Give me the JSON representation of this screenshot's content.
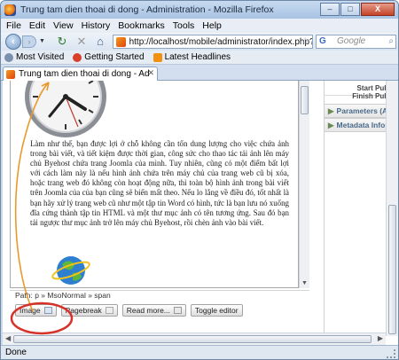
{
  "window": {
    "title": "Trung tam dien thoai di dong - Administration - Mozilla Firefox",
    "controls": {
      "minimize": "–",
      "maximize": "□",
      "close": "X"
    }
  },
  "menubar": {
    "items": [
      {
        "label": "File"
      },
      {
        "label": "Edit"
      },
      {
        "label": "View"
      },
      {
        "label": "History"
      },
      {
        "label": "Bookmarks"
      },
      {
        "label": "Tools"
      },
      {
        "label": "Help"
      }
    ]
  },
  "navigation": {
    "url": "http://localhost/mobile/administrator/index.php?o",
    "search_placeholder": "Google",
    "search_engine_label": "G"
  },
  "bookmarks": [
    {
      "label": "Most Visited",
      "icon": "gear-icon"
    },
    {
      "label": "Getting Started",
      "icon": "firefox-icon"
    },
    {
      "label": "Latest Headlines",
      "icon": "rss-icon"
    }
  ],
  "tab": {
    "label": "Trung tam dien thoai di dong - Admin..."
  },
  "editor": {
    "body_text": "Làm như thế, bạn được lợi ở chỗ không cần tốn dung lượng cho việc chứa ảnh trong bài viết, và tiết kiệm được thời gian, công sức cho thao tác tải ảnh lên máy chủ Byehost chứa trang Joomla của mình. Tuy nhiên, cũng có một điểm bất lợi với cách làm này là nếu hình ảnh chứa trên máy chủ của trang web cũ bị xóa, hoặc trang web đó không còn hoạt động nữa, thì toàn bộ hình ảnh trong bài viết trên Joomla của của bạn cũng sẽ biến mất theo. Nếu lo lắng về điều đó, tốt nhất là bạn hãy xử lý trang web cũ như một tập tin Word có hình, tức là bạn lưu nó xuống đĩa cứng thành tập tin HTML và một thư mục ảnh có tên tương ứng. Sau đó bạn tải ngược thư mục ảnh trở lên máy chủ Byehost, rồi chèn ảnh vào bài viết.",
    "path": "Path: p » MsoNormal » span",
    "buttons": {
      "image": "Image",
      "pagebreak": "Pagebreak",
      "readmore": "Read more...",
      "toggle": "Toggle editor"
    }
  },
  "right_panel": {
    "items": [
      {
        "label": "Start Publis"
      },
      {
        "label": "Finish Publis"
      }
    ],
    "accordions": [
      {
        "label": "Parameters (Ac"
      },
      {
        "label": "Metadata Inform"
      }
    ]
  },
  "status": {
    "text": "Done"
  },
  "colors": {
    "annotation_circle": "#d8312a",
    "annotation_arrow": "#e89a2a",
    "accordion_text": "#4a6a8a"
  }
}
